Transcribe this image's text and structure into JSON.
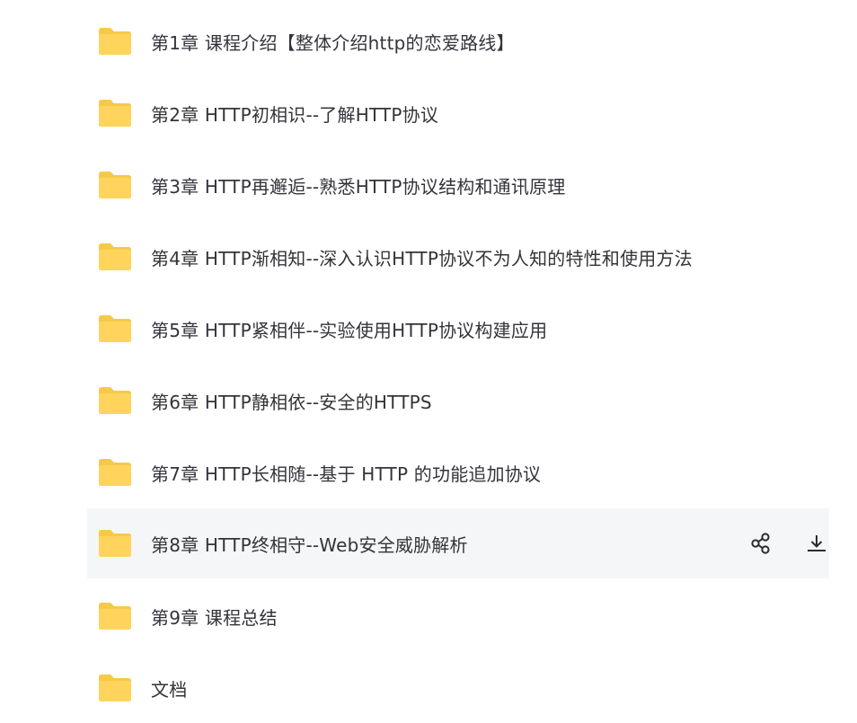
{
  "colors": {
    "folder_back": "#F7C948",
    "folder_front": "#FFD45C",
    "text": "#33343A",
    "hover_bg": "#F5F6F7",
    "icon": "#2B2C30"
  },
  "files": [
    {
      "name": "第1章 课程介绍【整体介绍http的恋爱路线】",
      "icon": "folder-icon"
    },
    {
      "name": "第2章 HTTP初相识--了解HTTP协议",
      "icon": "folder-icon"
    },
    {
      "name": "第3章 HTTP再邂逅--熟悉HTTP协议结构和通讯原理",
      "icon": "folder-icon"
    },
    {
      "name": "第4章 HTTP渐相知--深入认识HTTP协议不为人知的特性和使用方法",
      "icon": "folder-icon"
    },
    {
      "name": "第5章 HTTP紧相伴--实验使用HTTP协议构建应用",
      "icon": "folder-icon"
    },
    {
      "name": "第6章 HTTP静相依--安全的HTTPS",
      "icon": "folder-icon"
    },
    {
      "name": "第7章 HTTP长相随--基于 HTTP 的功能追加协议",
      "icon": "folder-icon"
    },
    {
      "name": "第8章 HTTP终相守--Web安全威胁解析",
      "icon": "folder-icon",
      "hovered": true,
      "actions": [
        "share-icon",
        "download-icon"
      ]
    },
    {
      "name": "第9章 课程总结",
      "icon": "folder-icon"
    },
    {
      "name": "文档",
      "icon": "folder-icon"
    }
  ]
}
